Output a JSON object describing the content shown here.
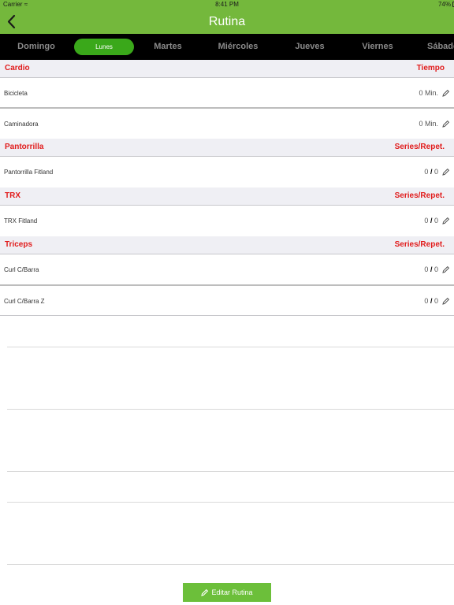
{
  "status": {
    "carrier": "Carrier",
    "time": "8:41 PM",
    "battery": "74%"
  },
  "nav": {
    "title": "Rutina"
  },
  "days": [
    "Domingo",
    "Lunes",
    "Martes",
    "Miércoles",
    "Jueves",
    "Viernes",
    "Sábado"
  ],
  "selected_day": "Lunes",
  "sections": [
    {
      "title": "Cardio",
      "column": "Tiempo",
      "items": [
        {
          "name": "Bicicleta",
          "value": "0 Min."
        },
        {
          "name": "Caminadora",
          "value": "0 Min."
        }
      ]
    },
    {
      "title": "Pantorrilla",
      "column": "Series/Repet.",
      "items": [
        {
          "name": "Pantorrilla Fitland",
          "sets": "0",
          "reps": "0"
        }
      ]
    },
    {
      "title": "TRX",
      "column": "Series/Repet.",
      "items": [
        {
          "name": "TRX Fitland",
          "sets": "0",
          "reps": "0"
        }
      ]
    },
    {
      "title": "Triceps",
      "column": "Series/Repet.",
      "items": [
        {
          "name": "Curl C/Barra",
          "sets": "0",
          "reps": "0"
        },
        {
          "name": "Curl C/Barra Z",
          "sets": "0",
          "reps": "0"
        }
      ]
    }
  ],
  "slash": "/",
  "edit_button": {
    "label": "Editar Rutina"
  },
  "colors": {
    "accent_green": "#74b83c",
    "selected_tab": "#3aa81a",
    "section_text": "#e11b1b",
    "button": "#6cbf3a"
  }
}
